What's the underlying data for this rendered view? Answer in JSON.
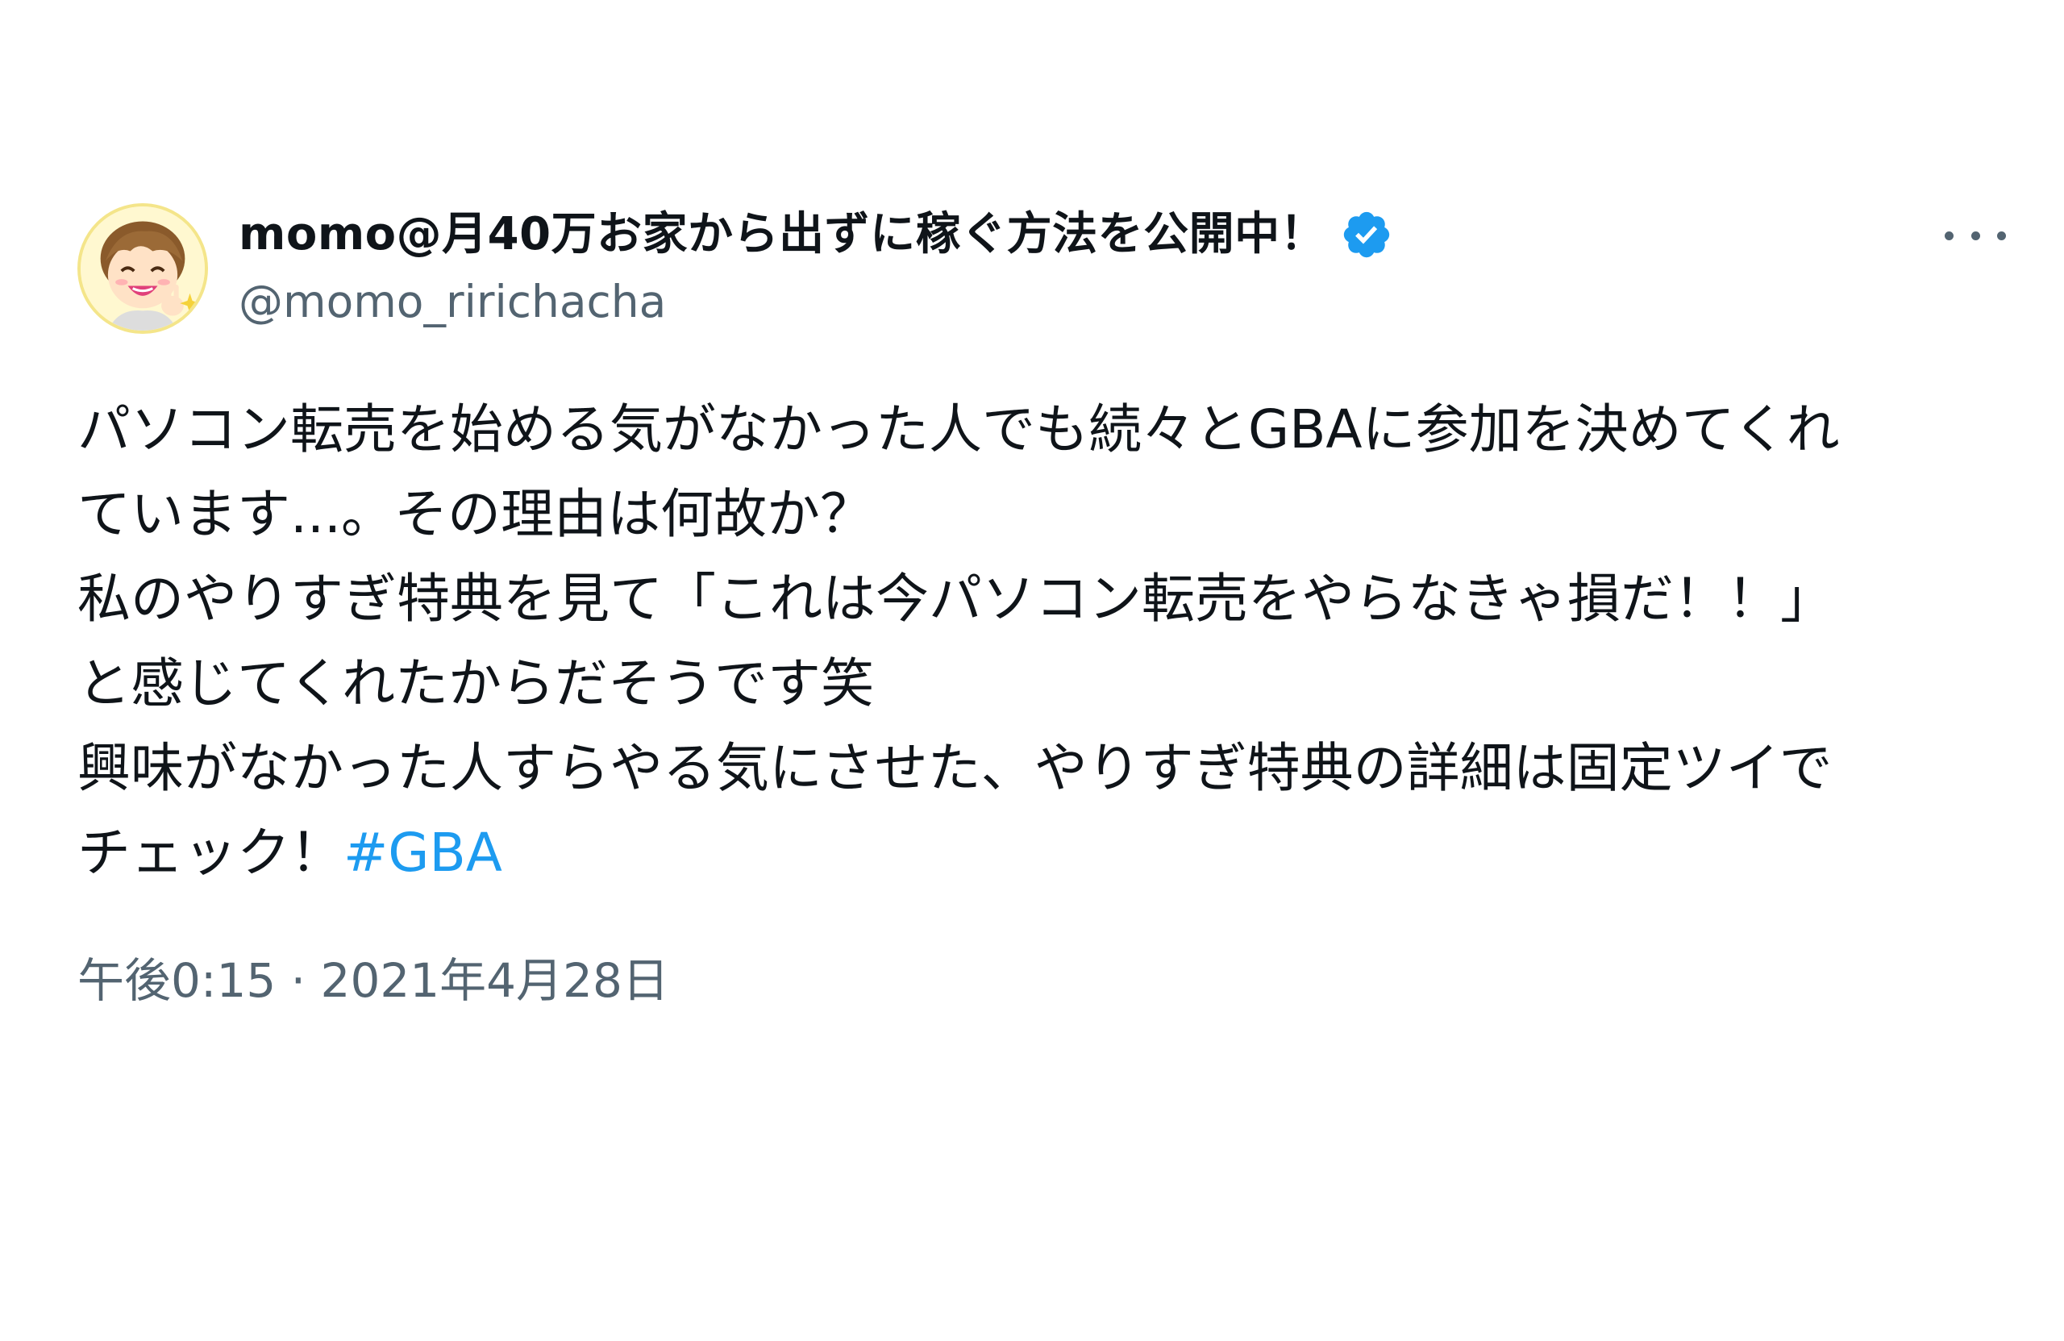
{
  "tweet": {
    "display_name": "momo@月40万お家から出ずに稼ぐ方法を公開中！",
    "handle": "@momo_ririchacha",
    "verified": true,
    "more_icon": "more-horizontal-icon",
    "body_lines": [
      "パソコン転売を始める気がなかった人でも続々とGBAに参加を決めてくれ",
      "ています...。その理由は何故か？",
      "私のやりすぎ特典を見て「これは今パソコン転売をやらなきゃ損だ！！」",
      "と感じてくれたからだそうです笑",
      "興味がなかった人すらやる気にさせた、やりすぎ特典の詳細は固定ツイで"
    ],
    "last_line_text": "チェック！",
    "hashtag": "#GBA",
    "timestamp": "午後0:15 · 2021年4月28日"
  },
  "colors": {
    "text": "#0f1419",
    "secondary": "#536471",
    "link": "#1d9bf0",
    "verified_badge": "#1d9bf0"
  }
}
